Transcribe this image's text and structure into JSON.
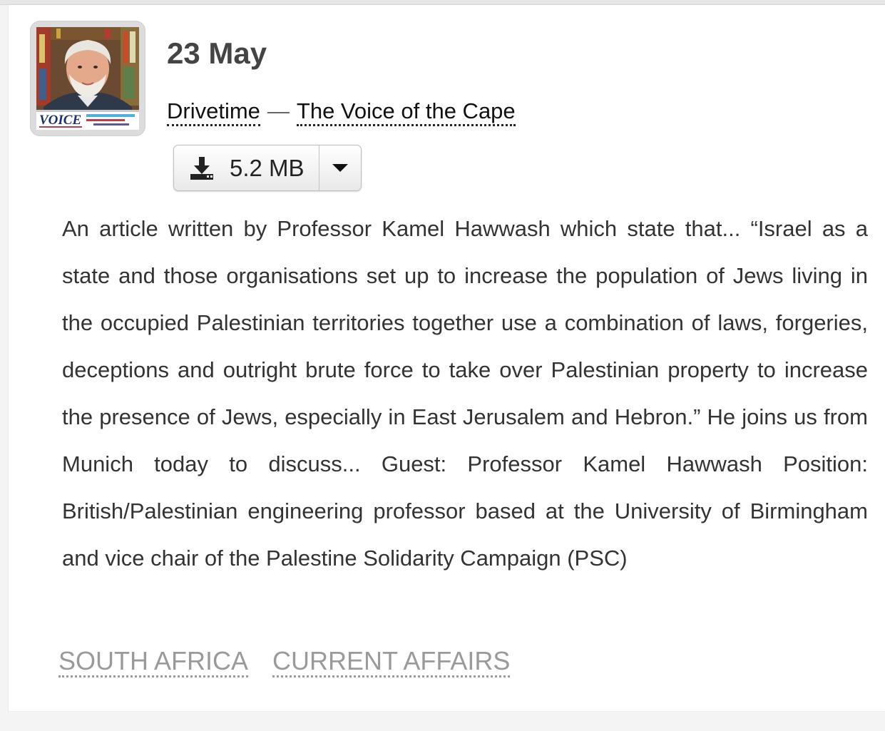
{
  "episode": {
    "date": "23 May",
    "show": "Drivetime",
    "separator": "—",
    "station": "The Voice of the Cape",
    "thumbnail_logo_text": "VOICE"
  },
  "download": {
    "size_label": "5.2 MB",
    "icon": "download-icon",
    "dropdown_icon": "caret-down-icon"
  },
  "description": "An article written by Professor Kamel Hawwash which state that... “Israel as a state and those organisations set up to increase the population of Jews living in the occupied Palestinian territories together use a combination of laws, forgeries, deceptions and outright brute force to take over Palestinian property to increase the presence of Jews, especially in East Jerusalem and Hebron.” He joins us from Munich today to discuss... Guest: Professor Kamel Hawwash Position: British/Palestinian engineering professor based at the University of Birmingham and vice chair of the Palestine Solidarity Campaign (PSC)",
  "tags": [
    "SOUTH AFRICA",
    "CURRENT AFFAIRS"
  ],
  "colors": {
    "text": "#333333",
    "tag": "#9a9a9a",
    "title": "#444444"
  }
}
